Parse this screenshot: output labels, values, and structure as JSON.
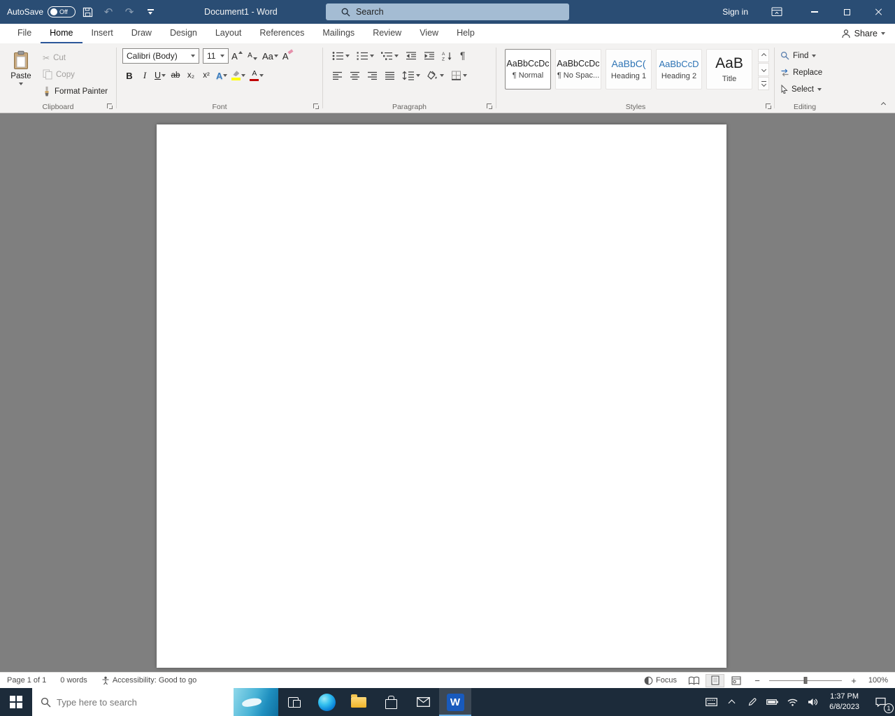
{
  "title_bar": {
    "autosave_label": "AutoSave",
    "autosave_state": "Off",
    "title": "Document1 - Word",
    "search_placeholder": "Search",
    "sign_in_label": "Sign in"
  },
  "tabs": [
    {
      "label": "File"
    },
    {
      "label": "Home"
    },
    {
      "label": "Insert"
    },
    {
      "label": "Draw"
    },
    {
      "label": "Design"
    },
    {
      "label": "Layout"
    },
    {
      "label": "References"
    },
    {
      "label": "Mailings"
    },
    {
      "label": "Review"
    },
    {
      "label": "View"
    },
    {
      "label": "Help"
    }
  ],
  "share_label": "Share",
  "ribbon": {
    "clipboard": {
      "label": "Clipboard",
      "paste": "Paste",
      "cut": "Cut",
      "copy": "Copy",
      "format_painter": "Format Painter"
    },
    "font": {
      "label": "Font",
      "font_name": "Calibri (Body)",
      "font_size": "11"
    },
    "paragraph": {
      "label": "Paragraph"
    },
    "styles": {
      "label": "Styles",
      "items": [
        {
          "preview": "AaBbCcDc",
          "name": "¶ Normal"
        },
        {
          "preview": "AaBbCcDc",
          "name": "¶ No Spac..."
        },
        {
          "preview": "AaBbC(",
          "name": "Heading 1"
        },
        {
          "preview": "AaBbCcD",
          "name": "Heading 2"
        },
        {
          "preview": "AaB",
          "name": "Title"
        }
      ]
    },
    "editing": {
      "label": "Editing",
      "find": "Find",
      "replace": "Replace",
      "select": "Select"
    }
  },
  "glyphs": {
    "undo": "↶",
    "redo": "↷",
    "scissors": "✂",
    "bold": "B",
    "italic": "I",
    "underline": "U",
    "strikethrough": "ab",
    "subscript": "x₂",
    "superscript": "x²",
    "text_effects": "A",
    "font_color": "A",
    "grow_font": "A",
    "shrink_font": "A",
    "change_case": "Aa",
    "clear_formatting": "A",
    "pilcrow": "¶",
    "sort_a": "A",
    "sort_z": "Z",
    "zoom_out": "−",
    "zoom_in": "+",
    "word_letter": "W"
  },
  "status_bar": {
    "page_info": "Page 1 of 1",
    "word_count": "0 words",
    "accessibility": "Accessibility: Good to go",
    "focus_label": "Focus",
    "zoom_level": "100%"
  },
  "taskbar": {
    "search_placeholder": "Type here to search",
    "time": "1:37 PM",
    "date": "6/8/2023",
    "notification_count": "1"
  },
  "colors": {
    "titlebar_blue": "#2a4d74",
    "accent_blue": "#2b579a",
    "heading_blue": "#2e74b5",
    "highlight_yellow": "#ffff00",
    "font_color_red": "#c00000",
    "document_gray": "#7f7f7f",
    "taskbar_dark": "#1c2b3a",
    "word_icon_blue": "#185abd"
  }
}
